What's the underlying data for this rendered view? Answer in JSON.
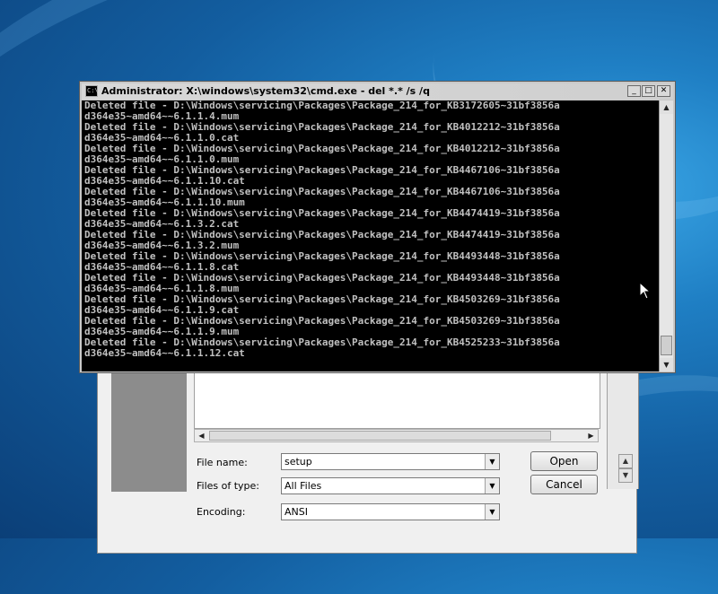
{
  "cmd_window": {
    "icon_text": "C:\\",
    "title": "Administrator: X:\\windows\\system32\\cmd.exe - del  *.* /s /q",
    "minimize_glyph": "_",
    "maximize_glyph": "□",
    "close_glyph": "✕",
    "scroll_up_glyph": "▲",
    "scroll_down_glyph": "▼",
    "console_lines": [
      "Deleted file - D:\\Windows\\servicing\\Packages\\Package_214_for_KB3172605~31bf3856a",
      "d364e35~amd64~~6.1.1.4.mum",
      "Deleted file - D:\\Windows\\servicing\\Packages\\Package_214_for_KB4012212~31bf3856a",
      "d364e35~amd64~~6.1.1.0.cat",
      "Deleted file - D:\\Windows\\servicing\\Packages\\Package_214_for_KB4012212~31bf3856a",
      "d364e35~amd64~~6.1.1.0.mum",
      "Deleted file - D:\\Windows\\servicing\\Packages\\Package_214_for_KB4467106~31bf3856a",
      "d364e35~amd64~~6.1.1.10.cat",
      "Deleted file - D:\\Windows\\servicing\\Packages\\Package_214_for_KB4467106~31bf3856a",
      "d364e35~amd64~~6.1.1.10.mum",
      "Deleted file - D:\\Windows\\servicing\\Packages\\Package_214_for_KB4474419~31bf3856a",
      "d364e35~amd64~~6.1.3.2.cat",
      "Deleted file - D:\\Windows\\servicing\\Packages\\Package_214_for_KB4474419~31bf3856a",
      "d364e35~amd64~~6.1.3.2.mum",
      "Deleted file - D:\\Windows\\servicing\\Packages\\Package_214_for_KB4493448~31bf3856a",
      "d364e35~amd64~~6.1.1.8.cat",
      "Deleted file - D:\\Windows\\servicing\\Packages\\Package_214_for_KB4493448~31bf3856a",
      "d364e35~amd64~~6.1.1.8.mum",
      "Deleted file - D:\\Windows\\servicing\\Packages\\Package_214_for_KB4503269~31bf3856a",
      "d364e35~amd64~~6.1.1.9.cat",
      "Deleted file - D:\\Windows\\servicing\\Packages\\Package_214_for_KB4503269~31bf3856a",
      "d364e35~amd64~~6.1.1.9.mum",
      "Deleted file - D:\\Windows\\servicing\\Packages\\Package_214_for_KB4525233~31bf3856a",
      "d364e35~amd64~~6.1.1.12.cat"
    ]
  },
  "open_dialog": {
    "file_name_label": "File name:",
    "file_name_value": "setup",
    "files_of_type_label": "Files of type:",
    "files_of_type_value": "All Files",
    "encoding_label": "Encoding:",
    "encoding_value": "ANSI",
    "open_button": "Open",
    "cancel_button": "Cancel",
    "combo_arrow_glyph": "▼",
    "scroll_left_glyph": "◀",
    "scroll_right_glyph": "▶",
    "scroll_up_glyph": "▲",
    "scroll_down_glyph": "▼"
  },
  "colors": {
    "console_background": "#000000",
    "console_text": "#c0c0c0",
    "desktop_blue": "#1f7fc4"
  }
}
